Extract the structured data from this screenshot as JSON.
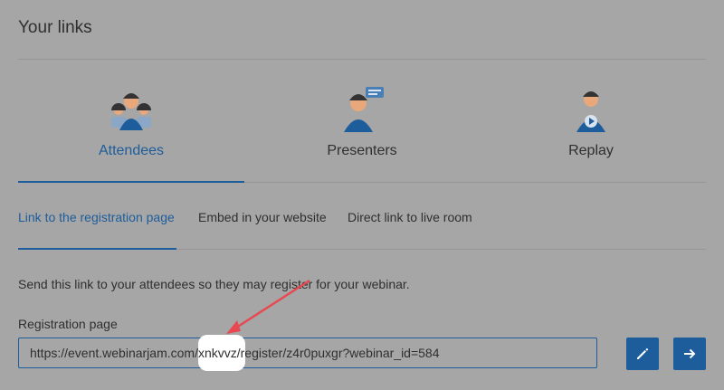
{
  "title": "Your links",
  "main_tabs": [
    {
      "label": "Attendees",
      "icon": "attendees-avatar-icon"
    },
    {
      "label": "Presenters",
      "icon": "presenter-avatar-icon"
    },
    {
      "label": "Replay",
      "icon": "replay-avatar-icon"
    }
  ],
  "sub_tabs": [
    {
      "label": "Link to the registration page"
    },
    {
      "label": "Embed in your website"
    },
    {
      "label": "Direct link to live room"
    }
  ],
  "description": "Send this link to your attendees so they may register for your webinar.",
  "registration": {
    "label": "Registration page",
    "url": "https://event.webinarjam.com/xnkvvz/register/z4r0puxgr?webinar_id=584"
  },
  "buttons": {
    "edit_icon": "pencil-icon",
    "open_icon": "arrow-right-icon"
  },
  "colors": {
    "accent": "#1d5d9b",
    "annotation": "#e8484f",
    "overlay": "#a6a6a6"
  }
}
